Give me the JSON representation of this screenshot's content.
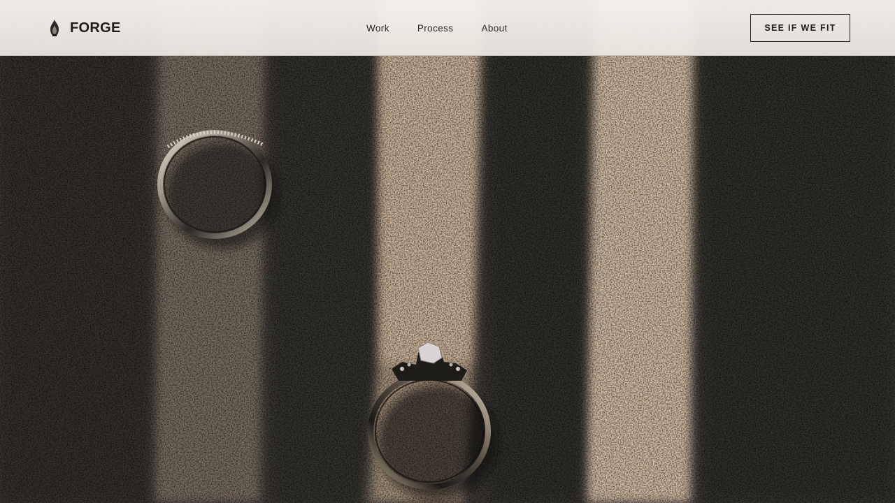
{
  "header": {
    "brand": {
      "icon": "flame-logo-icon",
      "name": "FORGE"
    },
    "nav": [
      {
        "label": "Work"
      },
      {
        "label": "Process"
      },
      {
        "label": "About"
      }
    ],
    "cta_label": "SEE IF WE FIT"
  },
  "hero": {
    "image": "two-rings-on-concrete-with-light-stripes",
    "colors": {
      "concrete_shadow": "#3a3733",
      "light_stripe": "#cdb49a",
      "ring_metal": "#bdb5a8"
    }
  }
}
